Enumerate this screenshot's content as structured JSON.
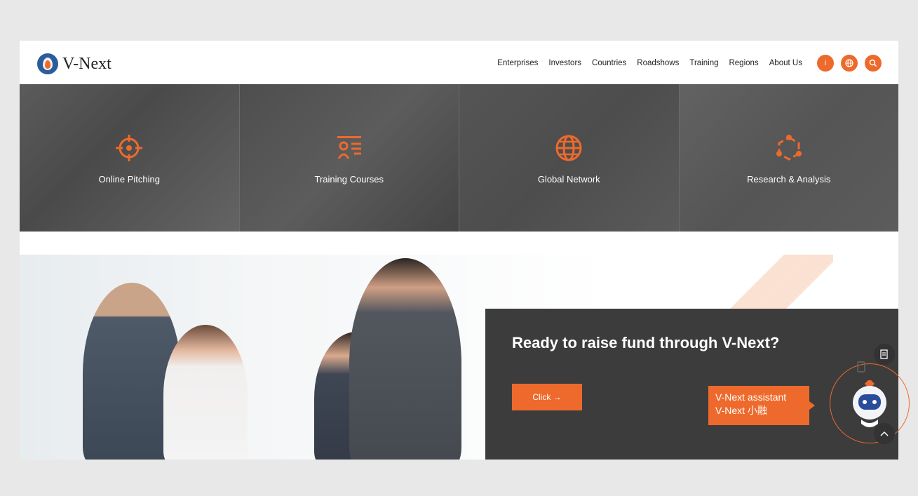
{
  "header": {
    "brand": "V-Next",
    "nav": [
      "Enterprises",
      "Investors",
      "Countries",
      "Roadshows",
      "Training",
      "Regions",
      "About Us"
    ],
    "circle_buttons": [
      {
        "icon": "info-icon",
        "label": "i"
      },
      {
        "icon": "globe-icon",
        "label": "◍"
      },
      {
        "icon": "search-icon",
        "label": "⌕"
      }
    ]
  },
  "tiles": [
    {
      "label": "Online Pitching",
      "icon": "target-icon"
    },
    {
      "label": "Training Courses",
      "icon": "course-icon"
    },
    {
      "label": "Global Network",
      "icon": "globe-icon"
    },
    {
      "label": "Research & Analysis",
      "icon": "network-icon"
    }
  ],
  "hero": {
    "title": "Ready to raise fund through V-Next?",
    "button": "Click →"
  },
  "assistant": {
    "line1": "V-Next assistant",
    "line2": "V-Next 小融"
  },
  "colors": {
    "accent": "#ee6a2c",
    "dark_panel": "#3c3c3c",
    "tile_overlay": "#555555"
  }
}
